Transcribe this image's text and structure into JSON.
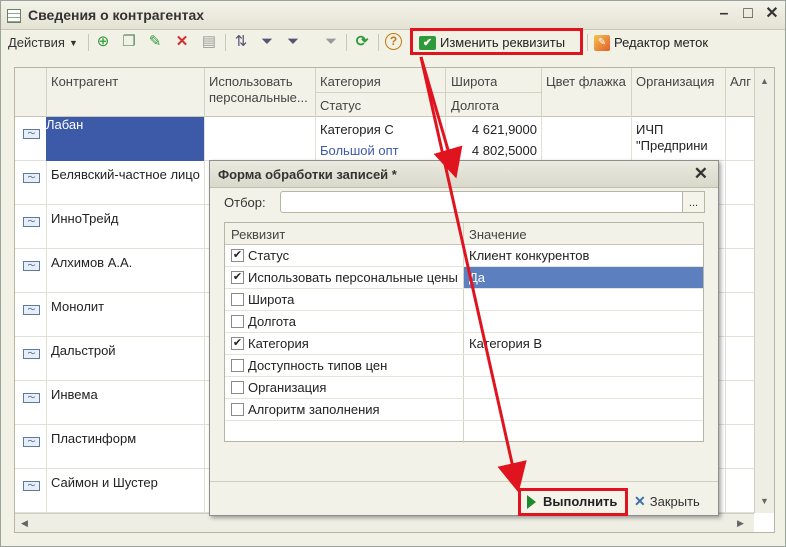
{
  "window": {
    "title": "Сведения о контрагентах"
  },
  "toolbar": {
    "actions_label": "Действия",
    "change_requisites_label": "Изменить реквизиты",
    "marks_editor_label": "Редактор меток"
  },
  "grid": {
    "columns": {
      "counterparty": "Контрагент",
      "use_personal": "Использовать персональные...",
      "category": "Категория",
      "status": "Статус",
      "latitude": "Широта",
      "longitude": "Долгота",
      "flag_color": "Цвет флажка",
      "organization": "Организация",
      "algorithm": "Алг"
    },
    "rows": [
      {
        "name": "Лабан",
        "category": "Категория С",
        "status": "Большой опт",
        "latitude": "4 621,9000",
        "longitude": "4 802,5000",
        "organization": "ИЧП \"Предприни"
      },
      {
        "name": "Белявский-частное лицо"
      },
      {
        "name": "ИнноТрейд"
      },
      {
        "name": "Алхимов А.А."
      },
      {
        "name": "Монолит"
      },
      {
        "name": "Дальстрой"
      },
      {
        "name": "Инвема"
      },
      {
        "name": "Пластинформ"
      },
      {
        "name": "Саймон и Шустер"
      }
    ]
  },
  "dialog": {
    "title": "Форма обработки записей *",
    "filter_label": "Отбор:",
    "filter_value": "",
    "filter_button": "...",
    "col_requisite": "Реквизит",
    "col_value": "Значение",
    "rows": [
      {
        "label": "Статус",
        "checked": true,
        "value": "Клиент конкурентов"
      },
      {
        "label": "Использовать персональные цены",
        "checked": true,
        "value": "Да",
        "selected": true
      },
      {
        "label": "Широта",
        "checked": false,
        "value": ""
      },
      {
        "label": "Долгота",
        "checked": false,
        "value": ""
      },
      {
        "label": "Категория",
        "checked": true,
        "value": "Категория В"
      },
      {
        "label": "Доступность типов цен",
        "checked": false,
        "value": ""
      },
      {
        "label": "Организация",
        "checked": false,
        "value": ""
      },
      {
        "label": "Алгоритм заполнения",
        "checked": false,
        "value": ""
      }
    ],
    "execute_label": "Выполнить",
    "close_label": "Закрыть"
  },
  "colors": {
    "highlight": "#e0141e",
    "selection": "#3c5aa8",
    "value_selection": "#5b7fbf"
  }
}
